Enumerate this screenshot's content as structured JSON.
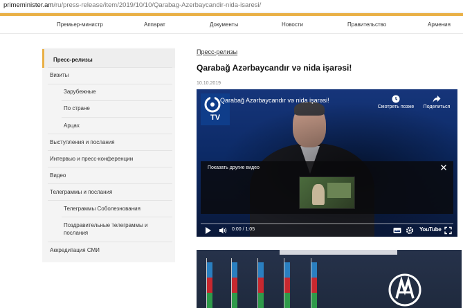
{
  "browser": {
    "url_host": "primeminister.am",
    "url_path": "/ru/press-release/item/2019/10/10/Qarabag-Azerbaycandir-nida-isaresi/"
  },
  "topnav": {
    "items": [
      "Премьер-министр",
      "Аппарат",
      "Документы",
      "Новости",
      "Правительство",
      "Армения"
    ]
  },
  "sidebar": {
    "items": [
      {
        "label": "Пресс-релизы"
      },
      {
        "label": "Визиты"
      },
      {
        "label": "Зарубежные"
      },
      {
        "label": "По стране"
      },
      {
        "label": "Арцах"
      },
      {
        "label": "Выступления и послания"
      },
      {
        "label": "Интервью и пресс-конференции"
      },
      {
        "label": "Видео"
      },
      {
        "label": "Телеграммы и послания"
      },
      {
        "label": "Телеграммы Соболезнования"
      },
      {
        "label": "Поздравительные телеграммы и послания"
      },
      {
        "label": "Аккредитация СМИ"
      }
    ]
  },
  "article": {
    "breadcrumb": "Пресс-релизы",
    "title": "Qarabağ Azərbaycandır və nida işarəsi!",
    "date": "10.10.2019"
  },
  "video": {
    "title": "Qarabağ Azərbaycandır və nida işarəsi!",
    "channel_badge": "TV",
    "watch_later": "Смотреть позже",
    "share": "Поделиться",
    "more_videos": "Показать другие видео",
    "time": "0:00 / 1:05",
    "brand": "YouTube",
    "progress": 0
  },
  "colors": {
    "accent": "#e9b046",
    "video_bg": "#0c2a66"
  }
}
